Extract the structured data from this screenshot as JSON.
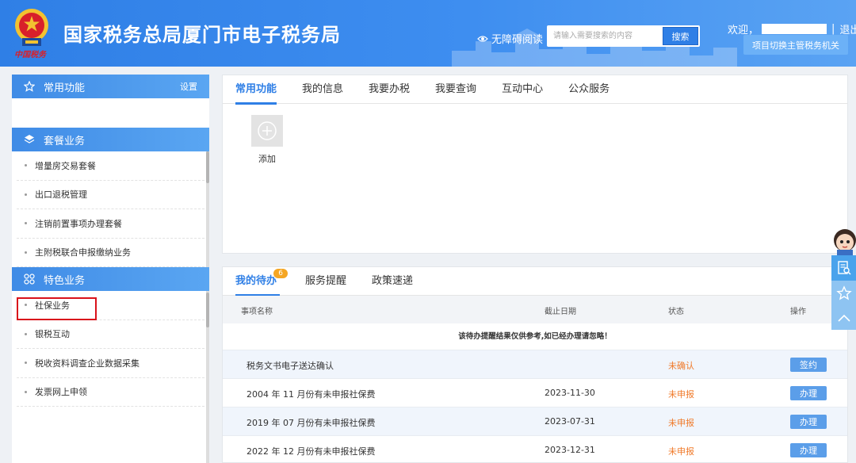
{
  "header": {
    "site_title": "国家税务总局厦门市电子税务局",
    "emblem_script": "中国税务",
    "accessible_reading": "无障碍阅读",
    "search_placeholder": "请输入需要搜索的内容",
    "search_button": "搜索",
    "welcome": "欢迎，",
    "logout": "退出",
    "switch_button": "项目切换主管税务机关"
  },
  "sidebar": {
    "common": {
      "title": "常用功能",
      "settings": "设置"
    },
    "package": {
      "title": "套餐业务",
      "items": [
        "增量房交易套餐",
        "出口退税管理",
        "注销前置事项办理套餐",
        "主附税联合申报缴纳业务"
      ]
    },
    "featured": {
      "title": "特色业务",
      "items": [
        "社保业务",
        "银税互动",
        "税收资料调查企业数据采集",
        "发票网上申领"
      ]
    }
  },
  "top_panel": {
    "tabs": [
      "常用功能",
      "我的信息",
      "我要办税",
      "我要查询",
      "互动中心",
      "公众服务"
    ],
    "add_label": "添加"
  },
  "todo_panel": {
    "tabs": [
      "我的待办",
      "服务提醒",
      "政策速递"
    ],
    "badge": "6",
    "columns": {
      "name": "事项名称",
      "deadline": "截止日期",
      "status": "状态",
      "action": "操作"
    },
    "notice": "该待办提醒结果仅供参考,如已经办理请忽略！",
    "rows": [
      {
        "name": "税务文书电子送达确认",
        "deadline": "",
        "status": "未确认",
        "action": "签约"
      },
      {
        "name": "2004 年 11 月份有未申报社保费",
        "deadline": "2023-11-30",
        "status": "未申报",
        "action": "办理"
      },
      {
        "name": "2019 年 07 月份有未申报社保费",
        "deadline": "2023-07-31",
        "status": "未申报",
        "action": "办理"
      },
      {
        "name": "2022 年 12 月份有未申报社保费",
        "deadline": "2023-12-31",
        "status": "未申报",
        "action": "办理"
      }
    ]
  },
  "colors": {
    "primary": "#2f7fe6",
    "status_warn": "#f07a2a",
    "highlight_box": "#d9121b"
  }
}
